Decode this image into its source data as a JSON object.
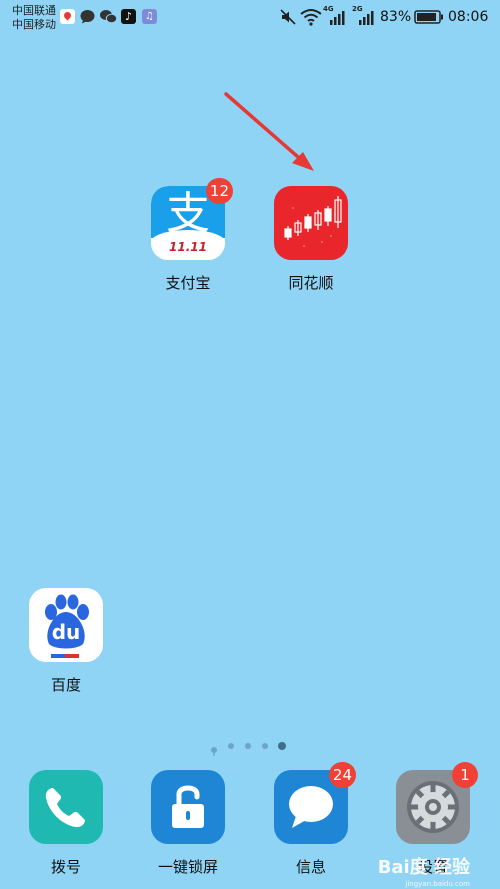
{
  "status_bar": {
    "carrier_1": "中国联通",
    "carrier_2": "中国移动",
    "network_1": "4G",
    "network_2": "2G",
    "battery_percent": "83%",
    "time": "08:06"
  },
  "annotation": {
    "arrow_color": "#e53935"
  },
  "apps": {
    "alipay": {
      "label": "支付宝",
      "badge": "12",
      "tile_text": "支",
      "banner": "11.11"
    },
    "tonghuashun": {
      "label": "同花顺"
    },
    "baidu": {
      "label": "百度",
      "tile_text": "du"
    }
  },
  "dock": {
    "phone": {
      "label": "拨号"
    },
    "lock": {
      "label": "一键锁屏"
    },
    "messages": {
      "label": "信息",
      "badge": "24"
    },
    "settings": {
      "label": "设置",
      "badge": "1"
    }
  },
  "page_indicator": {
    "count": 5,
    "active_index": 4
  },
  "watermark": {
    "text": "Bai度 经验",
    "sub": "jingyan.baidu.com"
  },
  "colors": {
    "wallpaper": "#8fd4f5",
    "badge": "#ef4135",
    "alipay": "#1aa0ea",
    "tonghuashun": "#e8262b",
    "phone": "#1fb9b2",
    "lock": "#1f86d6",
    "messages": "#1f86d6",
    "settings": "#8a8f96"
  }
}
